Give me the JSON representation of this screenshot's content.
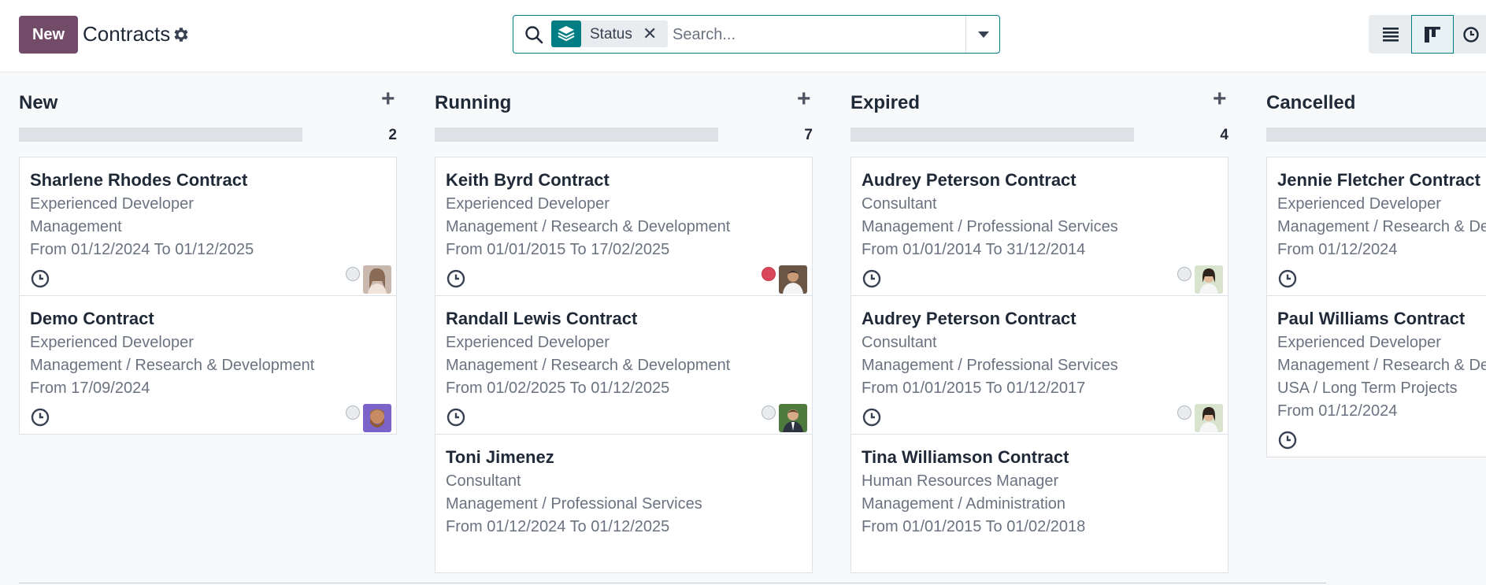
{
  "header": {
    "new_label": "New",
    "title": "Contracts"
  },
  "search": {
    "facet_label": "Status",
    "placeholder": "Search..."
  },
  "views": [
    "list-icon",
    "kanban-icon",
    "activity-icon"
  ],
  "colors": {
    "brand": "#714b67",
    "accent": "#017e84",
    "priority_red": "#d9485a"
  },
  "columns": [
    {
      "title": "New",
      "count": "2",
      "cards": [
        {
          "title": "Sharlene Rhodes Contract",
          "job": "Experienced Developer",
          "department": "Management",
          "dates": "From 01/12/2024 To 01/12/2025",
          "state": "grey"
        },
        {
          "title": "Demo Contract",
          "job": "Experienced Developer",
          "department": "Management / Research & Development",
          "dates": "From 17/09/2024",
          "state": "grey"
        }
      ]
    },
    {
      "title": "Running",
      "count": "7",
      "cards": [
        {
          "title": "Keith Byrd Contract",
          "job": "Experienced Developer",
          "department": "Management / Research & Development",
          "dates": "From 01/01/2015 To 17/02/2025",
          "state": "red"
        },
        {
          "title": "Randall Lewis Contract",
          "job": "Experienced Developer",
          "department": "Management / Research & Development",
          "dates": "From 01/02/2025 To 01/12/2025",
          "state": "grey"
        },
        {
          "title": "Toni Jimenez",
          "job": "Consultant",
          "department": "Management / Professional Services",
          "dates": "From 01/12/2024 To 01/12/2025"
        }
      ]
    },
    {
      "title": "Expired",
      "count": "4",
      "cards": [
        {
          "title": "Audrey Peterson Contract",
          "job": "Consultant",
          "department": "Management / Professional Services",
          "dates": "From 01/01/2014 To 31/12/2014",
          "state": "grey"
        },
        {
          "title": "Audrey Peterson Contract",
          "job": "Consultant",
          "department": "Management / Professional Services",
          "dates": "From 01/01/2015 To 01/12/2017",
          "state": "grey"
        },
        {
          "title": "Tina Williamson Contract",
          "job": "Human Resources Manager",
          "department": "Management / Administration",
          "dates": "From 01/01/2015 To 01/02/2018"
        }
      ]
    },
    {
      "title": "Cancelled",
      "cards": [
        {
          "title": "Jennie Fletcher Contract",
          "job": "Experienced Developer",
          "department": "Management / Research & Development",
          "dates": "From 01/12/2024"
        },
        {
          "title": "Paul Williams Contract",
          "job": "Experienced Developer",
          "department": "Management / Research & Development",
          "extra": "USA / Long Term Projects",
          "dates": "From 01/12/2024"
        }
      ]
    }
  ]
}
